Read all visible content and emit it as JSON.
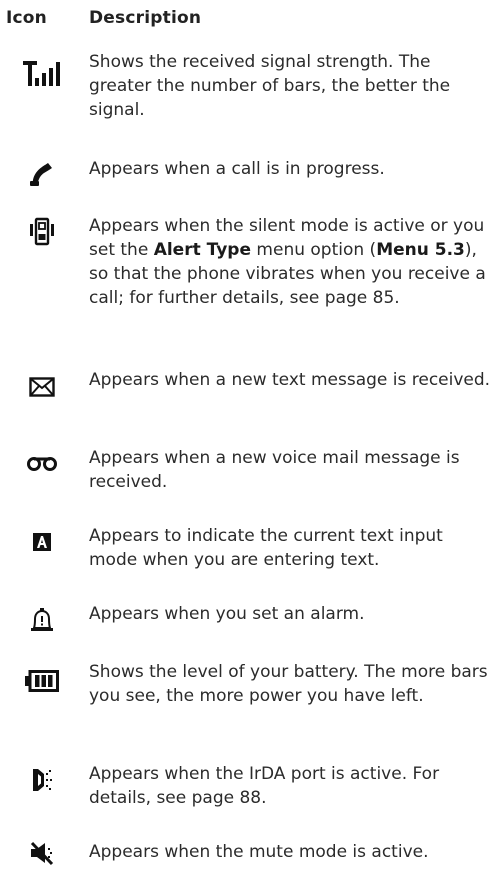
{
  "header": {
    "icon_label": "Icon",
    "desc_label": "Description"
  },
  "rows": [
    {
      "icon": "signal-strength-icon",
      "text": "Shows the received signal strength. The greater the number of bars, the better the signal."
    },
    {
      "icon": "call-in-progress-icon",
      "text": "Appears when a call is in progress."
    },
    {
      "icon": "vibrate-icon",
      "t1": "Appears when the silent mode is active or you set the ",
      "b1": "Alert Type",
      "t2": " menu option (",
      "b2": "Menu 5.3",
      "t3": "), so that the phone vibrates when you receive a call; for further details, see page 85."
    },
    {
      "icon": "envelope-icon",
      "text": "Appears when a new text message is received."
    },
    {
      "icon": "voicemail-icon",
      "text": "Appears when a new voice mail message is received."
    },
    {
      "icon": "text-input-mode-icon",
      "text": "Appears to indicate the current text input mode when you are entering text."
    },
    {
      "icon": "alarm-bell-icon",
      "text": "Appears when you set an alarm."
    },
    {
      "icon": "battery-level-icon",
      "text": "Shows the level of your battery. The more bars you see, the more power you have left."
    },
    {
      "icon": "irda-port-icon",
      "text": "Appears when the IrDA port is active. For details, see page 88."
    },
    {
      "icon": "mute-icon",
      "text": "Appears when the mute mode is active."
    }
  ]
}
